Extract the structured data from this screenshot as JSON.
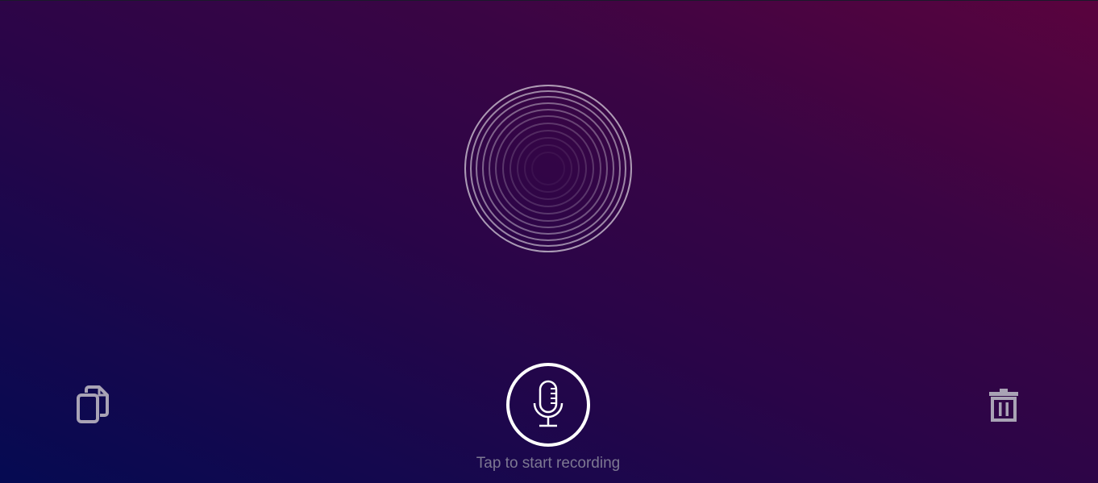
{
  "status_text": "Tap to start recording",
  "icons": {
    "copy": "copy-icon",
    "microphone": "microphone-icon",
    "trash": "trash-icon",
    "visualizer": "ring-visualizer"
  },
  "colors": {
    "gradient_bottom_left": "#050a52",
    "gradient_mid": "#2a0548",
    "gradient_top_right": "#5a033e",
    "icon_gray": "#a9a3b5",
    "mic_ring": "#ffffff",
    "status_text": "#7d7892"
  }
}
